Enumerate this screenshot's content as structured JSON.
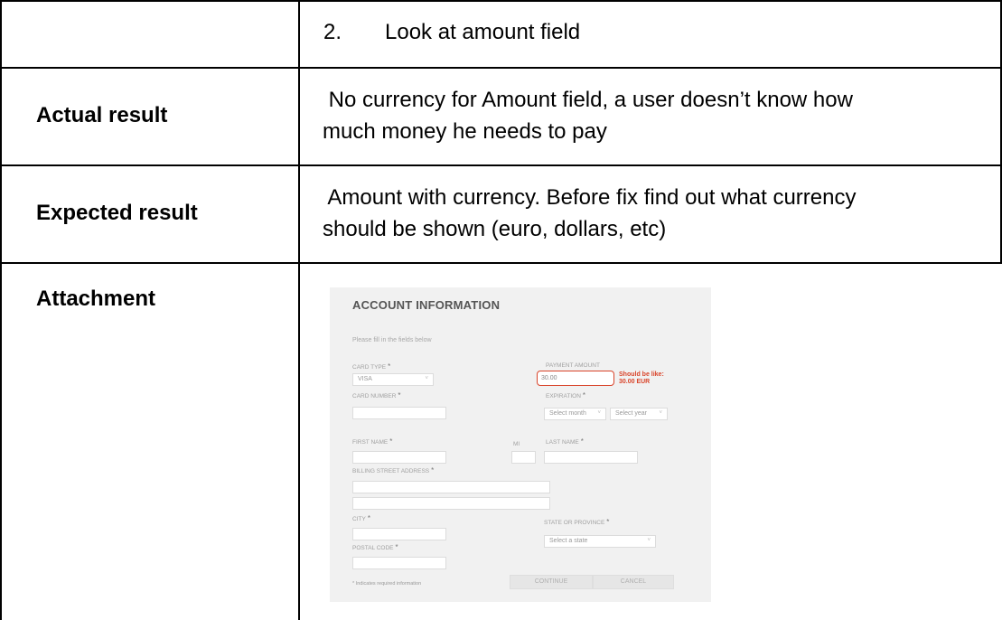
{
  "table": {
    "rows": [
      {
        "label": "",
        "content": "2.  Look at amount field"
      },
      {
        "label": "Actual result",
        "content_lines": [
          " No currency for Amount field, a user doesn’t know how",
          "much money he needs to pay"
        ]
      },
      {
        "label": "Expected result",
        "content_lines": [
          " Amount with currency. Before fix find out what currency",
          "should be shown (euro, dollars, etc)"
        ]
      },
      {
        "label": "Attachment"
      }
    ]
  },
  "attachment": {
    "title": "ACCOUNT INFORMATION",
    "subtitle": "Please fill in the fields below",
    "card_type": {
      "label": "CARD TYPE",
      "value": "VISA"
    },
    "payment_amount": {
      "label": "PAYMENT AMOUNT",
      "value": "30.00"
    },
    "annotation": {
      "line1": "Should be like:",
      "line2": "30.00 EUR"
    },
    "card_number": {
      "label": "CARD NUMBER"
    },
    "expiration": {
      "label": "EXPIRATION",
      "month": "Select month",
      "year": "Select year"
    },
    "first_name": {
      "label": "FIRST NAME"
    },
    "mi": {
      "label": "MI"
    },
    "last_name": {
      "label": "LAST NAME"
    },
    "billing": {
      "label": "BILLING STREET ADDRESS"
    },
    "city": {
      "label": "CITY"
    },
    "state": {
      "label": "STATE OR PROVINCE",
      "value": "Select a state"
    },
    "postal": {
      "label": "POSTAL CODE"
    },
    "required_note": "* Indicates required information",
    "continue_label": "CONTINUE",
    "cancel_label": "CANCEL",
    "star": "*",
    "chevron": "˅"
  },
  "colors": {
    "annotation": "#d9442a",
    "form_bg": "#f1f1f1"
  }
}
